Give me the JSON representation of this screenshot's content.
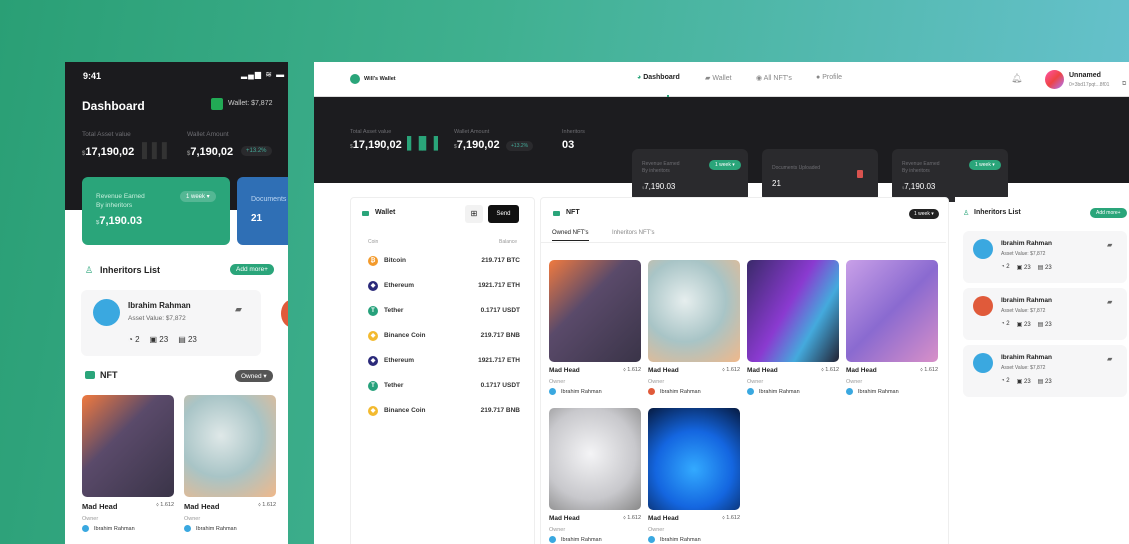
{
  "mobile": {
    "time": "9:41",
    "title": "Dashboard",
    "wallet": "Wallet: $7,872",
    "total_label": "Total Asset value",
    "total_value": "17,190,02",
    "wallet_label": "Wallet Amount",
    "wallet_value": "7,190,02",
    "change": "+13.2%",
    "revenue_label1": "Revenue Earned",
    "revenue_label2": "By inheritors",
    "revenue_period": "1 week",
    "revenue_value": "7,190.03",
    "documents_label": "Documents",
    "documents_value": "21",
    "inheritors_title": "Inheritors List",
    "add_more": "Add more+",
    "inheritor": {
      "name": "Ibrahim Rahman",
      "asset": "Asset Value: $7,872",
      "s1": "2",
      "s2": "23",
      "s3": "23"
    },
    "nft_title": "NFT",
    "nft_filter": "Owned",
    "nfts": [
      {
        "name": "Mad Head",
        "price": "1.612",
        "owner_label": "Owner",
        "owner": "Ibrahim Rahman"
      },
      {
        "name": "Mad Head",
        "price": "1.612",
        "owner_label": "Owner",
        "owner": "Ibrahim Rahman"
      }
    ]
  },
  "desktop": {
    "brand": "Will's Wallet",
    "nav": [
      "Dashboard",
      "Wallet",
      "All NFT's",
      "Profile"
    ],
    "user": "Unnamed",
    "address": "0×3bd17pqt...8f01",
    "total_label": "Total Asset value",
    "total_value": "17,190,02",
    "wallet_label": "Wallet Amount",
    "wallet_value": "7,190,02",
    "change": "+13.2%",
    "inheritors_label": "Inheritors",
    "inheritors_value": "03",
    "card1": {
      "l1": "Revenue Earned",
      "l2": "By inheritors",
      "period": "1 week",
      "value": "7,190.03"
    },
    "card2": {
      "l1": "Documents Uploaded",
      "value": "21"
    },
    "card3": {
      "l1": "Revenue Earned",
      "l2": "By inheritors",
      "period": "1 week",
      "value": "7,190.03"
    },
    "wallet": {
      "title": "Wallet",
      "send": "Send",
      "col_coin": "Coin",
      "col_balance": "Balance",
      "coins": [
        {
          "name": "Bitcoin",
          "balance": "219.717 BTC",
          "color": "#f39a2b",
          "sym": "₿"
        },
        {
          "name": "Ethereum",
          "balance": "1921.717 ETH",
          "color": "#2b2a7a",
          "sym": "◆"
        },
        {
          "name": "Tether",
          "balance": "0.1717 USDT",
          "color": "#26a17b",
          "sym": "T"
        },
        {
          "name": "Binance Coin",
          "balance": "219.717 BNB",
          "color": "#f3ba2f",
          "sym": "◆"
        },
        {
          "name": "Ethereum",
          "balance": "1921.717 ETH",
          "color": "#2b2a7a",
          "sym": "◆"
        },
        {
          "name": "Tether",
          "balance": "0.1717 USDT",
          "color": "#26a17b",
          "sym": "T"
        },
        {
          "name": "Binance Coin",
          "balance": "219.717 BNB",
          "color": "#f3ba2f",
          "sym": "◆"
        }
      ]
    },
    "nft": {
      "title": "NFT",
      "period": "1 week",
      "tabs": [
        "Owned NFT's",
        "Inheritors NFT's"
      ],
      "items": [
        {
          "name": "Mad Head",
          "price": "1.612",
          "owner_label": "Owner",
          "owner": "Ibrahim Rahman"
        },
        {
          "name": "Mad Head",
          "price": "1.612",
          "owner_label": "Owner",
          "owner": "Ibrahim Rahman"
        },
        {
          "name": "Mad Head",
          "price": "1.612",
          "owner_label": "Owner",
          "owner": "Ibrahim Rahman"
        },
        {
          "name": "Mad Head",
          "price": "1.612",
          "owner_label": "Owner",
          "owner": "Ibrahim Rahman"
        },
        {
          "name": "Mad Head",
          "price": "1.612",
          "owner_label": "Owner",
          "owner": "Ibrahim Rahman"
        },
        {
          "name": "Mad Head",
          "price": "1.612",
          "owner_label": "Owner",
          "owner": "Ibrahim Rahman"
        }
      ]
    },
    "inheritors": {
      "title": "Inheritors List",
      "add_more": "Add more+",
      "items": [
        {
          "name": "Ibrahim Rahman",
          "asset": "Asset Value: $7,872",
          "s1": "2",
          "s2": "23",
          "s3": "23"
        },
        {
          "name": "Ibrahim Rahman",
          "asset": "Asset Value: $7,872",
          "s1": "2",
          "s2": "23",
          "s3": "23"
        },
        {
          "name": "Ibrahim Rahman",
          "asset": "Asset Value: $7,872",
          "s1": "2",
          "s2": "23",
          "s3": "23"
        }
      ]
    }
  },
  "colors": {
    "accent": "#2aa57a",
    "dark": "#1c1c1f",
    "blue_card": "#2f6fb5"
  }
}
